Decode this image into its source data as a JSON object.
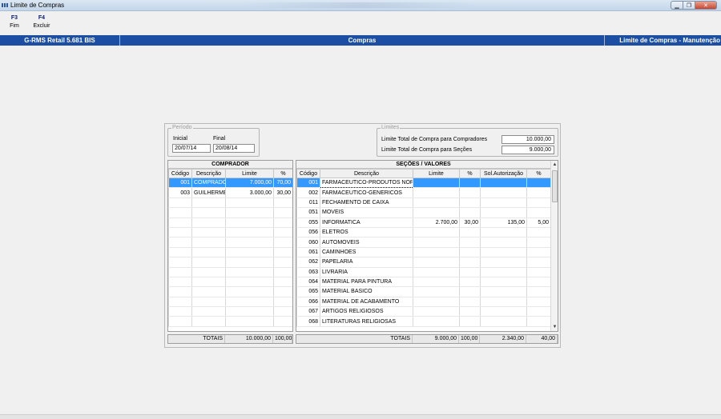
{
  "window": {
    "title": "Limite de Compras"
  },
  "toolbar": {
    "items": [
      {
        "key": "F3",
        "label": "Fim"
      },
      {
        "key": "F4",
        "label": "Excluir"
      }
    ]
  },
  "header": {
    "app": "G-RMS Retail 5.681 BIS",
    "module": "Compras",
    "screen": "Limite de Compras - Manutenção"
  },
  "periodo": {
    "legend": "Período",
    "inicial_label": "Inicial",
    "inicial_value": "20/07/14",
    "final_label": "Final",
    "final_value": "20/08/14"
  },
  "limites": {
    "legend": "Limites",
    "compradores_label": "Limite Total de Compra para Compradores",
    "compradores_value": "10.000,00",
    "secoes_label": "Limite Total de Compra para Seções",
    "secoes_value": "9.000,00"
  },
  "comprador": {
    "title": "COMPRADOR",
    "columns": [
      "Código",
      "Descrição",
      "Limite",
      "%"
    ],
    "rows": [
      [
        "001",
        "COMPRADOI",
        "7.000,00",
        "70,00"
      ],
      [
        "003",
        "GUILHERME",
        "3.000,00",
        "30,00"
      ],
      [
        "",
        "",
        "",
        ""
      ],
      [
        "",
        "",
        "",
        ""
      ],
      [
        "",
        "",
        "",
        ""
      ],
      [
        "",
        "",
        "",
        ""
      ],
      [
        "",
        "",
        "",
        ""
      ],
      [
        "",
        "",
        "",
        ""
      ],
      [
        "",
        "",
        "",
        ""
      ],
      [
        "",
        "",
        "",
        ""
      ],
      [
        "",
        "",
        "",
        ""
      ],
      [
        "",
        "",
        "",
        ""
      ],
      [
        "",
        "",
        "",
        ""
      ],
      [
        "",
        "",
        "",
        ""
      ],
      [
        "",
        "",
        "",
        ""
      ]
    ],
    "totals": [
      "TOTAIS",
      "10.000,00",
      "100,00"
    ]
  },
  "secoes": {
    "title": "SEÇÕES / VALORES",
    "columns": [
      "Código",
      "Descrição",
      "Limite",
      "%",
      "Sol.Autorização",
      "%"
    ],
    "rows": [
      [
        "001",
        "FARMACEUTICO-PRODUTOS NORMA",
        "",
        "",
        "",
        ""
      ],
      [
        "002",
        "FARMACEUTICO-GENERICOS",
        "",
        "",
        "",
        ""
      ],
      [
        "011",
        "FECHAMENTO DE CAIXA",
        "",
        "",
        "",
        ""
      ],
      [
        "051",
        "MOVEIS",
        "",
        "",
        "",
        ""
      ],
      [
        "055",
        "INFORMATICA",
        "2.700,00",
        "30,00",
        "135,00",
        "5,00"
      ],
      [
        "056",
        "ELETROS",
        "",
        "",
        "",
        ""
      ],
      [
        "060",
        "AUTOMOVEIS",
        "",
        "",
        "",
        ""
      ],
      [
        "061",
        "CAMINHOES",
        "",
        "",
        "",
        ""
      ],
      [
        "062",
        "PAPELARIA",
        "",
        "",
        "",
        ""
      ],
      [
        "063",
        "LIVRARIA",
        "",
        "",
        "",
        ""
      ],
      [
        "064",
        "MATERIAL PARA PINTURA",
        "",
        "",
        "",
        ""
      ],
      [
        "065",
        "MATERIAL BASICO",
        "",
        "",
        "",
        ""
      ],
      [
        "066",
        "MATERIAL DE ACABAMENTO",
        "",
        "",
        "",
        ""
      ],
      [
        "067",
        "ARTIGOS RELIGIOSOS",
        "",
        "",
        "",
        ""
      ],
      [
        "068",
        "LITERATURAS RELIGIOSAS",
        "",
        "",
        "",
        ""
      ]
    ],
    "totals": [
      "TOTAIS",
      "9.000,00",
      "100,00",
      "2.340,00",
      "40,00"
    ]
  },
  "colors": {
    "header_blue": "#1c4fa3",
    "selection": "#3399ff"
  }
}
